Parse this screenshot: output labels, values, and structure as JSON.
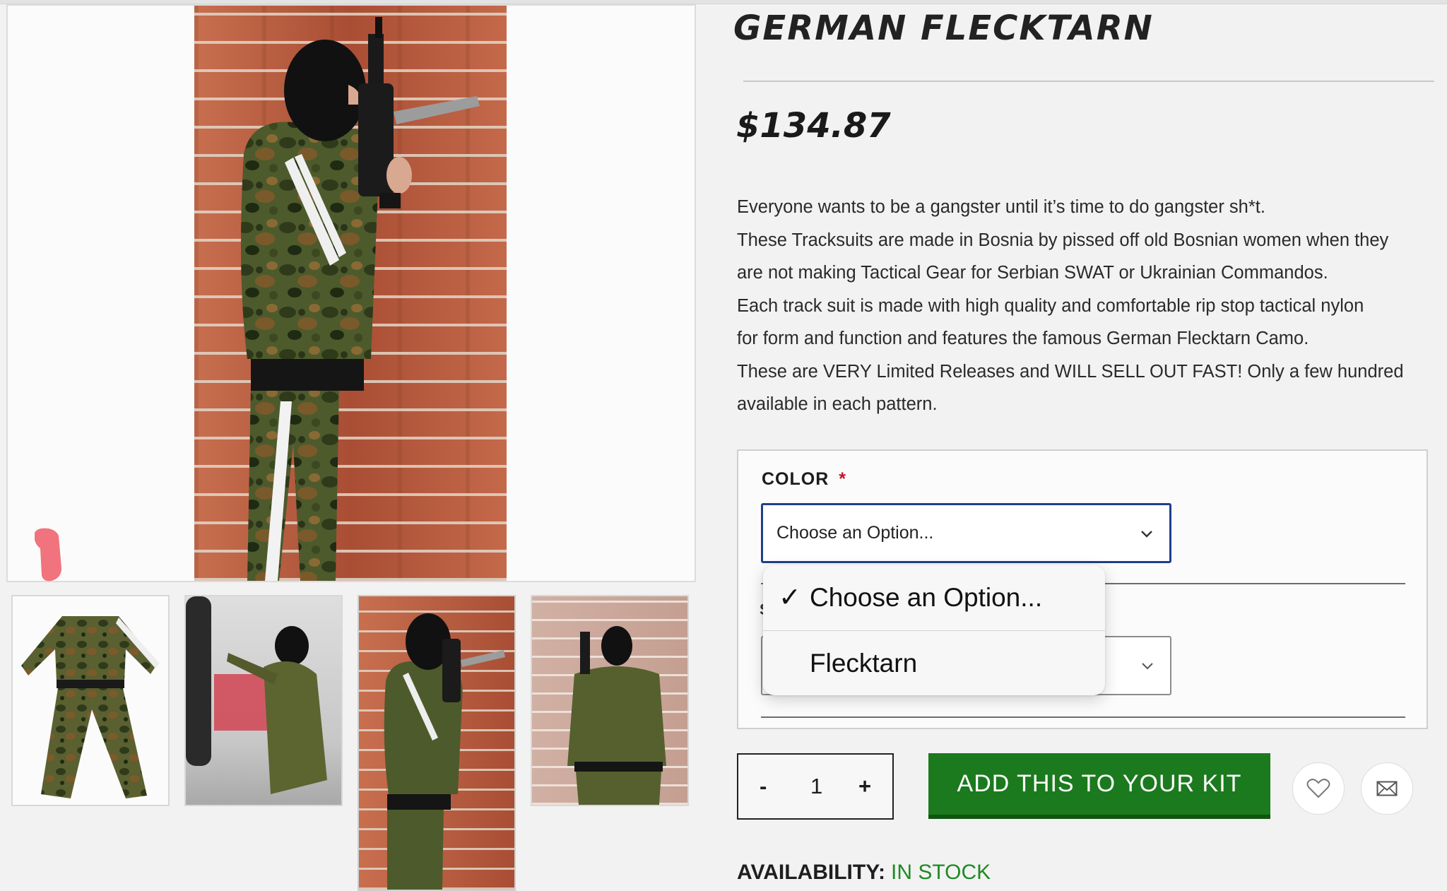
{
  "product": {
    "title": "GERMAN FLECKTARN",
    "price": "$134.87",
    "description": [
      "Everyone wants to be a gangster until it’s time to do gangster sh*t.",
      "These Tracksuits are made in Bosnia by pissed off old Bosnian women when they",
      "are not making Tactical Gear for Serbian SWAT or Ukrainian Commandos.",
      "Each track suit is made with high quality and comfortable rip stop tactical nylon",
      "for form and function and features the famous German Flecktarn Camo.",
      "These are VERY Limited Releases and WILL SELL OUT FAST! Only a few hundred",
      "available in each pattern."
    ]
  },
  "options": {
    "color_label": "COLOR",
    "required_mark": "*",
    "color_select_value": "Choose an Option...",
    "size_peek": "S",
    "dropdown_items": [
      {
        "label": "Choose an Option...",
        "selected": true,
        "check": "✓"
      },
      {
        "label": "Flecktarn",
        "selected": false
      }
    ]
  },
  "cart": {
    "minus": "-",
    "quantity": "1",
    "plus": "+",
    "add_button": "ADD THIS TO YOUR KIT"
  },
  "availability": {
    "label": "AVAILABILITY:",
    "value": "IN STOCK"
  },
  "colors": {
    "accent_green": "#1b7a1e",
    "in_stock_green": "#1f8a24",
    "select_focus_border": "#1f3f8a",
    "required_red": "#c8102e"
  },
  "icons": [
    "zoom-badge-icon",
    "chevron-down-icon",
    "checkmark-icon",
    "heart-icon",
    "mail-icon"
  ]
}
